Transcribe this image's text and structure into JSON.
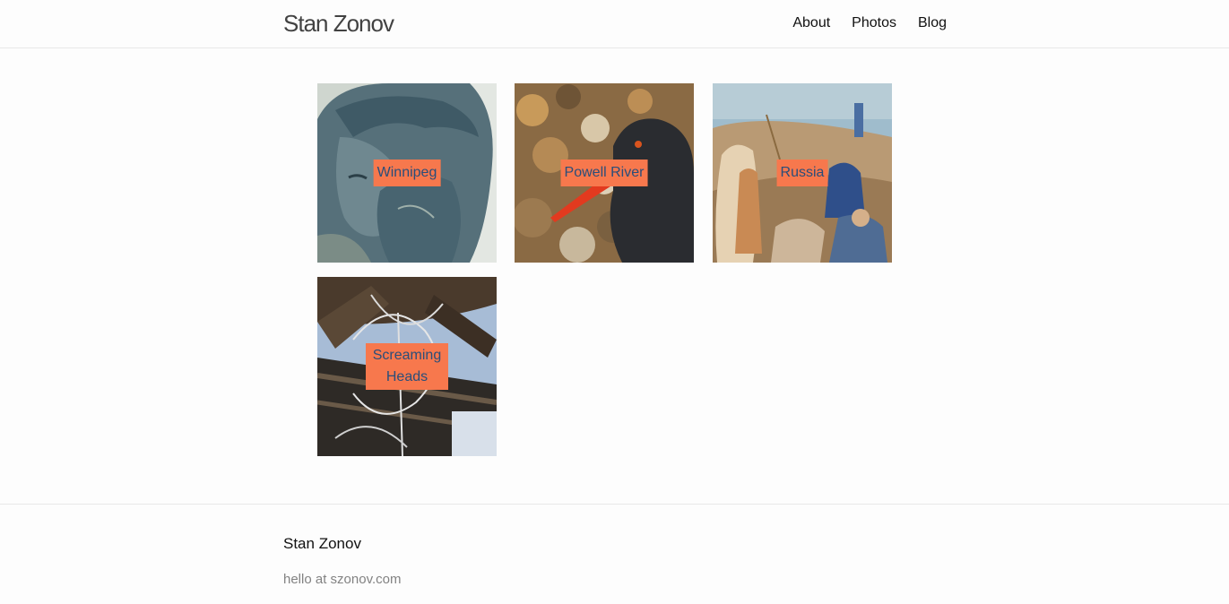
{
  "header": {
    "site_title": "Stan Zonov",
    "nav": [
      {
        "label": "About"
      },
      {
        "label": "Photos"
      },
      {
        "label": "Blog"
      }
    ]
  },
  "gallery": {
    "tiles": [
      {
        "label": "Winnipeg",
        "image": "bronze-statue-face"
      },
      {
        "label": "Powell River",
        "image": "black-oystercatcher-bird"
      },
      {
        "label": "Russia",
        "image": "religious-painting-crowd"
      },
      {
        "label": "Screaming Heads",
        "image": "wooden-tower-branches"
      }
    ]
  },
  "footer": {
    "title": "Stan Zonov",
    "email": "hello at szonov.com"
  },
  "colors": {
    "label_bg": "#f7784d",
    "label_text": "#2a4e7a"
  }
}
